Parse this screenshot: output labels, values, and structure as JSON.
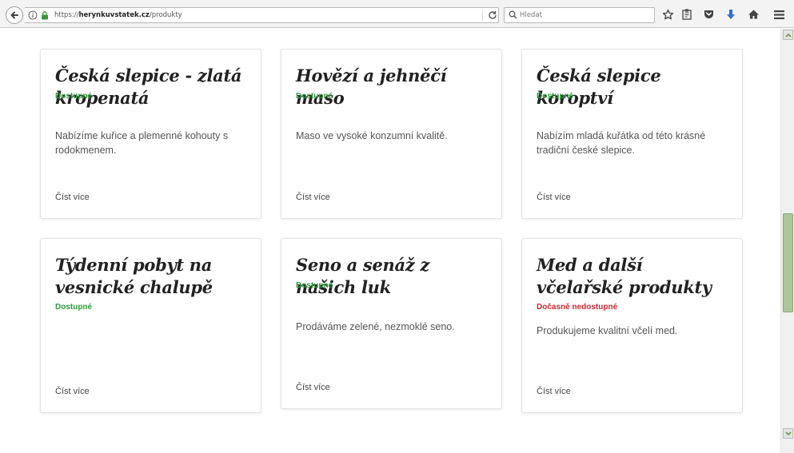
{
  "browser": {
    "url_prefix": "https://",
    "url_domain": "herynkuvstatek.cz",
    "url_path": "/produkty",
    "search_placeholder": "Hledat"
  },
  "products": [
    {
      "title": "Česká slepice - zlatá kropenatá",
      "status": "Dostupné",
      "available": true,
      "description": "Nabízíme kuřice a plemenné kohouty s rodokmenem.",
      "more": "Číst více"
    },
    {
      "title": "Hovězí a jehněčí maso",
      "status": "Dostupné",
      "available": true,
      "description": "Maso ve vysoké konzumní kvalitě.",
      "more": "Číst více"
    },
    {
      "title": "Česká slepice koroptví",
      "status": "Dostupné",
      "available": true,
      "description": "Nabízím mladá kuřátka od této krásné tradiční české slepice.",
      "more": "Číst více"
    },
    {
      "title": "Týdenní pobyt na vesnické chalupě",
      "status": "Dostupné",
      "available": true,
      "description": "",
      "more": "Číst více"
    },
    {
      "title": "Seno a senáž z našich luk",
      "status": "Dostupné",
      "available": true,
      "description": "Prodáváme zelené, nezmoklé seno.",
      "more": "Číst více"
    },
    {
      "title": "Med a další včelařské produkty",
      "status": "Dočasně nedostupné",
      "available": false,
      "description": "Produkujeme kvalitní včelí med.",
      "more": "Číst více"
    }
  ]
}
